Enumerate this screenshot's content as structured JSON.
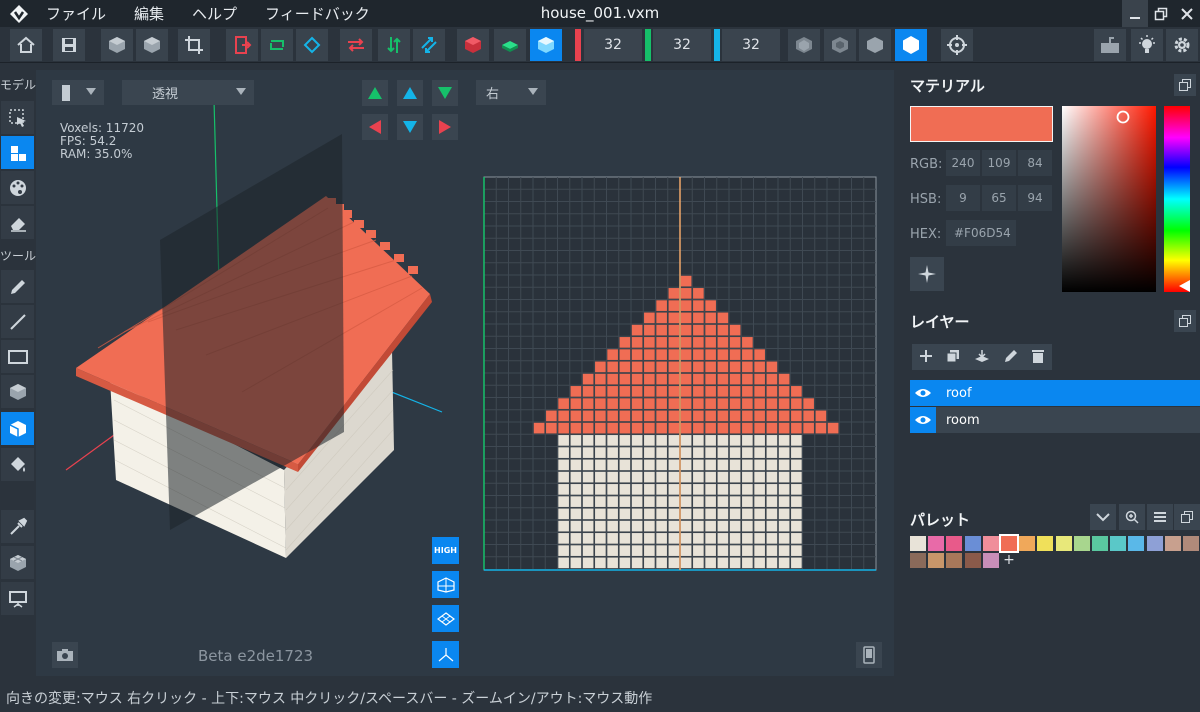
{
  "app": {
    "title": "house_001.vxm",
    "menu": [
      "ファイル",
      "編集",
      "ヘルプ",
      "フィードバック"
    ]
  },
  "toolbar": {
    "buttons": [
      "home-icon",
      "save-icon",
      "cube-up-icon",
      "cube-down-icon",
      "crop-icon",
      "export-icon",
      "refresh-icon",
      "rotate-icon",
      "swap-x-icon",
      "swap-y-icon",
      "swap-z-icon",
      "cube-red-icon",
      "cube-green-icon",
      "cube-blue-icon",
      "cube-outline-icon",
      "cube-wire-icon",
      "cube-solid-icon",
      "cube-white-icon",
      "target-icon",
      "keyboard-icon",
      "bulb-icon",
      "gear-icon"
    ],
    "size_x": "32",
    "size_y": "32",
    "size_z": "32",
    "colors": {
      "x": "#e8424f",
      "y": "#16c06a",
      "z": "#14b4e8",
      "accent": "#0a87f0"
    }
  },
  "left_tools": {
    "model_label": "モデル",
    "tools_label": "ツール"
  },
  "viewport": {
    "view_mode": "透視",
    "side_view": "右",
    "stats": {
      "voxels": "Voxels: 11720",
      "fps": "FPS: 54.2",
      "ram": "RAM: 35.0%"
    },
    "quality": "HIGH",
    "version": "Beta e2de1723"
  },
  "material": {
    "title": "マテリアル",
    "color": "#f06d54",
    "rgb_label": "RGB:",
    "rgb": [
      "240",
      "109",
      "84"
    ],
    "hsb_label": "HSB:",
    "hsb": [
      "9",
      "65",
      "94"
    ],
    "hex_label": "HEX:",
    "hex": "#F06D54"
  },
  "layers": {
    "title": "レイヤー",
    "items": [
      {
        "name": "roof",
        "selected": true
      },
      {
        "name": "room",
        "selected": false
      }
    ]
  },
  "palette": {
    "title": "パレット",
    "colors": [
      "#e8e3d8",
      "#e86aa8",
      "#e85a8a",
      "#6a8ed6",
      "#f08e9a",
      "#f06d54",
      "#f0a85a",
      "#f0e05a",
      "#e8e87a",
      "#a8d68e",
      "#5ac8a0",
      "#5ac8c8",
      "#5ab8e8",
      "#8ea0d6",
      "#c8a08e",
      "#b08a7a",
      "#8a6a5a",
      "#c8966a",
      "#a8785a",
      "#8a5a4a",
      "#c88eb8"
    ],
    "selected": 5,
    "add_label": "+"
  },
  "status": {
    "text": "向きの変更:マウス 右クリック - 上下:マウス 中クリック/スペースバー - ズームイン/アウト:マウス動作"
  }
}
